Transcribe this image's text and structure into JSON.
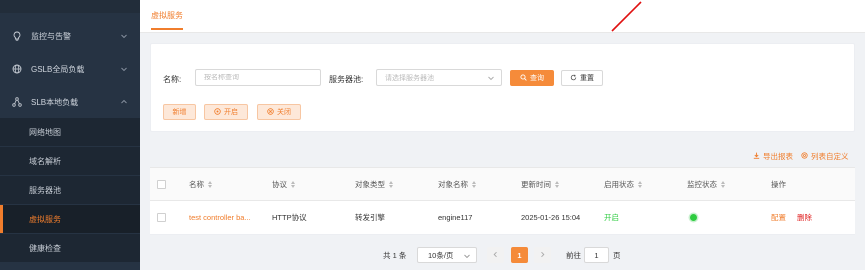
{
  "sidebar": {
    "groups": [
      {
        "label": "监控与告警",
        "icon": "lightbulb-icon"
      },
      {
        "label": "GSLB全局负载",
        "icon": "globe-icon"
      },
      {
        "label": "SLB本地负载",
        "icon": "network-icon"
      }
    ],
    "sub_items": [
      {
        "label": "网络地图"
      },
      {
        "label": "域名解析"
      },
      {
        "label": "服务器池"
      },
      {
        "label": "虚拟服务"
      },
      {
        "label": "健康检查"
      }
    ],
    "active_item": "虚拟服务"
  },
  "tabs": [
    {
      "label": "虚拟服务"
    }
  ],
  "filter": {
    "name_label": "名称:",
    "name_placeholder": "按名称查询",
    "pool_label": "服务器池:",
    "pool_placeholder": "请选择服务器池",
    "search_label": "查询",
    "reset_label": "重置",
    "add_label": "新增",
    "enable_label": "开启",
    "disable_label": "关闭"
  },
  "toolbar": {
    "export_label": "导出报表",
    "custom_label": "列表自定义"
  },
  "table": {
    "columns": [
      "名称",
      "协议",
      "对象类型",
      "对象名称",
      "更新时间",
      "启用状态",
      "监控状态",
      "操作"
    ],
    "rows": [
      {
        "name": "test controller ba...",
        "protocol": "HTTP协议",
        "object_type": "转发引擎",
        "object_name": "engine117",
        "updated": "2025-01-26 15:04",
        "enabled": "开启",
        "monitor_status": "online",
        "action_config": "配置",
        "action_delete": "删除"
      }
    ]
  },
  "pagination": {
    "total": "共 1 条",
    "page_size": "10条/页",
    "current_page": "1",
    "goto_label": "前往",
    "goto_value": "1",
    "page_suffix": "页"
  },
  "colors": {
    "accent": "#f07d2c",
    "sidebar_bg": "#263343",
    "enabled_green": "#2ecc40",
    "delete_red": "#e02020",
    "annotation_arrow": "#e01010"
  }
}
